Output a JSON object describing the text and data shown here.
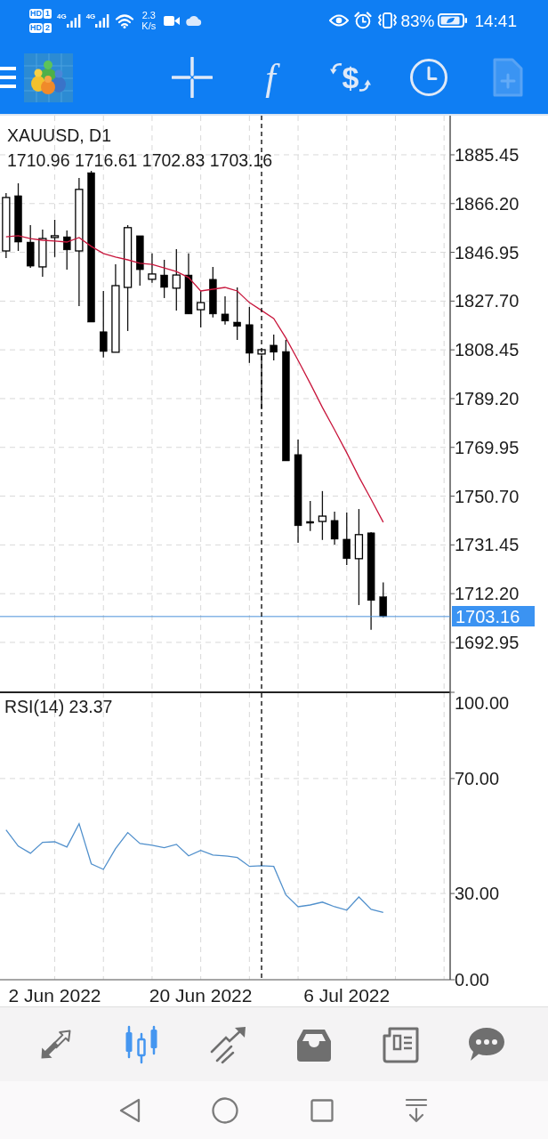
{
  "status_bar": {
    "sims": [
      {
        "badge": "HD",
        "slot": "1"
      },
      {
        "badge": "HD",
        "slot": "2"
      }
    ],
    "networks": [
      "4G",
      "4G"
    ],
    "speed": {
      "value": "2.3",
      "unit": "K/s"
    },
    "battery": "83%",
    "time": "14:41"
  },
  "toolbar": {
    "items": [
      {
        "kind": "crosshair",
        "disabled": false
      },
      {
        "kind": "indicators",
        "label": "f",
        "disabled": false
      },
      {
        "kind": "trade",
        "label": "$",
        "disabled": false
      },
      {
        "kind": "periods",
        "disabled": false
      },
      {
        "kind": "new_order",
        "disabled": true
      }
    ]
  },
  "chart": {
    "symbol": "XAUUSD, D1",
    "ohlc": "1710.96 1716.61 1702.83 1703.16",
    "current_price": "1703.16",
    "chart_data": {
      "type": "candlestick",
      "grid": true,
      "categories": [
        null,
        null,
        null,
        null,
        null,
        null,
        null,
        null,
        null,
        null,
        null,
        null,
        null,
        null,
        null,
        null,
        null,
        null,
        null,
        null,
        null,
        null,
        null,
        null,
        null,
        null,
        null,
        null,
        null,
        null,
        null,
        null,
        null,
        null,
        null,
        null,
        null
      ],
      "ylim": [
        1673.6,
        1900.9
      ],
      "yticks": [
        {
          "value": 1885.45,
          "label": "1885.45"
        },
        {
          "value": 1866.2,
          "label": "1866.20"
        },
        {
          "value": 1846.95,
          "label": "1846.95"
        },
        {
          "value": 1827.7,
          "label": "1827.70"
        },
        {
          "value": 1808.45,
          "label": "1808.45"
        },
        {
          "value": 1789.2,
          "label": "1789.20"
        },
        {
          "value": 1769.95,
          "label": "1769.95"
        },
        {
          "value": 1750.7,
          "label": "1750.70"
        },
        {
          "value": 1731.45,
          "label": "1731.45"
        },
        {
          "value": 1712.2,
          "label": "1712.20"
        },
        {
          "value": 1692.95,
          "label": "1692.95"
        }
      ],
      "ohlc": [
        [
          1847.5,
          1870.3,
          1844.7,
          1868.6
        ],
        [
          1869.3,
          1874.2,
          1847.5,
          1851.0
        ],
        [
          1851.0,
          1857.7,
          1840.8,
          1841.5
        ],
        [
          1841.2,
          1855.9,
          1837.3,
          1852.4
        ],
        [
          1852.8,
          1859.8,
          1845.1,
          1853.5
        ],
        [
          1853.1,
          1855.6,
          1840.1,
          1847.9
        ],
        [
          1847.5,
          1876.3,
          1825.7,
          1871.8
        ],
        [
          1878.4,
          1879.1,
          1819.4,
          1819.4
        ],
        [
          1815.6,
          1831.7,
          1805.4,
          1807.8
        ],
        [
          1807.5,
          1842.2,
          1807.5,
          1833.8
        ],
        [
          1833.1,
          1857.7,
          1815.9,
          1856.7
        ],
        [
          1853.5,
          1853.5,
          1833.8,
          1840.1
        ],
        [
          1836.3,
          1846.5,
          1834.9,
          1838.4
        ],
        [
          1838.0,
          1844.0,
          1828.9,
          1833.1
        ],
        [
          1832.8,
          1848.2,
          1824.0,
          1838.0
        ],
        [
          1838.0,
          1846.5,
          1822.6,
          1822.6
        ],
        [
          1824.3,
          1831.7,
          1817.3,
          1827.1
        ],
        [
          1836.3,
          1841.2,
          1821.2,
          1822.6
        ],
        [
          1822.6,
          1829.6,
          1818.4,
          1819.8
        ],
        [
          1819.4,
          1833.1,
          1812.4,
          1817.7
        ],
        [
          1818.4,
          1825.4,
          1803.3,
          1807.1
        ],
        [
          1806.8,
          1808.5,
          1785.0,
          1808.5
        ],
        [
          1810.3,
          1814.5,
          1804.3,
          1807.5
        ],
        [
          1807.8,
          1812.4,
          1764.6,
          1764.6
        ],
        [
          1767.1,
          1773.0,
          1732.3,
          1739.0
        ],
        [
          1740.7,
          1748.8,
          1736.9,
          1740.0
        ],
        [
          1740.7,
          1752.7,
          1733.4,
          1742.8
        ],
        [
          1741.1,
          1744.6,
          1731.6,
          1733.7
        ],
        [
          1733.7,
          1744.2,
          1723.5,
          1726.0
        ],
        [
          1726.0,
          1745.6,
          1707.7,
          1735.5
        ],
        [
          1736.2,
          1736.5,
          1697.9,
          1709.5
        ],
        [
          1710.96,
          1716.61,
          1702.83,
          1703.16
        ],
        null,
        null,
        null,
        null,
        null
      ],
      "series": [
        {
          "type": "line",
          "color": "#c8163c",
          "values": [
            1853.1,
            1853.5,
            1852.4,
            1851.7,
            1851.4,
            1851.0,
            1852.8,
            1849.3,
            1846.5,
            1845.1,
            1844.0,
            1842.6,
            1842.2,
            1840.8,
            1839.4,
            1837.0,
            1831.7,
            1832.4,
            1833.1,
            1831.7,
            1827.1,
            1824.0,
            1820.8,
            1813.1,
            1804.3,
            1795.2,
            1785.7,
            1776.9,
            1767.8,
            1758.3,
            1749.5,
            1740.4,
            null,
            null,
            null,
            null,
            null
          ]
        }
      ],
      "ref_lines": [
        {
          "axis": "y",
          "value": 1703.16,
          "color": "#4a90d9"
        }
      ]
    }
  },
  "rsi": {
    "chart_data": {
      "type": "line",
      "title": "RSI(14) 23.37",
      "grid": true,
      "categories": [
        null,
        null,
        null,
        null,
        "2 Jun 2022",
        null,
        null,
        null,
        null,
        null,
        null,
        null,
        null,
        null,
        null,
        null,
        "20 Jun 2022",
        null,
        null,
        null,
        null,
        null,
        null,
        null,
        null,
        null,
        null,
        null,
        "6 Jul 2022",
        null,
        null,
        null,
        null,
        null,
        null,
        null,
        null
      ],
      "ylim": [
        0,
        100
      ],
      "yticks": [
        {
          "value": 100,
          "label": "100.00"
        },
        {
          "value": 70,
          "label": "70.00"
        },
        {
          "value": 30,
          "label": "30.00"
        },
        {
          "value": 0,
          "label": "0.00"
        }
      ],
      "series": [
        {
          "color": "#5190cc",
          "values": [
            52.1,
            46.5,
            44.0,
            47.8,
            48.0,
            46.2,
            54.3,
            40.3,
            38.4,
            45.6,
            51.2,
            47.4,
            46.8,
            45.9,
            47.1,
            43.1,
            45.0,
            43.4,
            43.1,
            42.5,
            39.4,
            39.7,
            39.4,
            29.5,
            25.4,
            26.0,
            27.0,
            25.4,
            24.2,
            28.8,
            24.5,
            23.4,
            null,
            null,
            null,
            null,
            null
          ]
        }
      ]
    }
  },
  "tabs": [
    {
      "kind": "quotes",
      "selected": false
    },
    {
      "kind": "chart",
      "selected": true
    },
    {
      "kind": "trade",
      "selected": false
    },
    {
      "kind": "history",
      "selected": false
    },
    {
      "kind": "news",
      "selected": false
    },
    {
      "kind": "messages",
      "selected": false
    }
  ]
}
